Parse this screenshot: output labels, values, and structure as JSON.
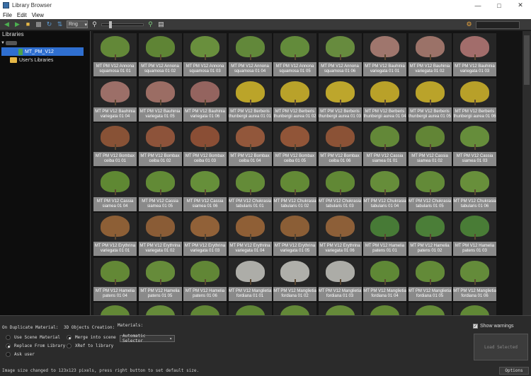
{
  "window": {
    "title": "Library Browser"
  },
  "menu": [
    "File",
    "Edit",
    "View"
  ],
  "toolbar": {
    "select_value": "Rng"
  },
  "left_panel": {
    "header": "Libraries",
    "items": [
      {
        "label": "MT_PM_V12",
        "selected": true
      },
      {
        "label": "User's Libraries",
        "selected": false
      }
    ]
  },
  "grid": {
    "tiles": [
      [
        "MT PM V12 Annona squamosa 01 01",
        "MT PM V12 Annona squamosa 01 02",
        "MT PM V12 Annona squamosa 01 03",
        "MT PM V12 Annona squamosa 01 04",
        "MT PM V12 Annona squamosa 01 05",
        "MT PM V12 Annona squamosa 01 06",
        "MT PM V12 Bauhinia variegata 01 01",
        "MT PM V12 Bauhinia variegata 01 02",
        "MT PM V12 Bauhinia variegata 01 03"
      ],
      [
        "MT PM V12 Bauhinia variegata 01 04",
        "MT PM V12 Bauhinia variegata 01 05",
        "MT PM V12 Bauhinia variegata 01 06",
        "MT PM V12 Berberis thunbergii aurea 01 01",
        "MT PM V12 Berberis thunbergii aurea 01 02",
        "MT PM V12 Berberis thunbergii aurea 01 03",
        "MT PM V12 Berberis thunbergii aurea 01 04",
        "MT PM V12 Berberis thunbergii aurea 01 05",
        "MT PM V12 Berberis thunbergii aurea 01 06"
      ],
      [
        "MT PM V12 Bombax ceiba 01 01",
        "MT PM V12 Bombax ceiba 01 02",
        "MT PM V12 Bombax ceiba 01 03",
        "MT PM V12 Bombax ceiba 01 04",
        "MT PM V12 Bombax ceiba 01 05",
        "MT PM V12 Bombax ceiba 01 06",
        "MT PM V12 Cassia siamea 01 01",
        "MT PM V12 Cassia siamea 01 02",
        "MT PM V12 Cassia siamea 01 03"
      ],
      [
        "MT PM V12 Cassia siamea 01 04",
        "MT PM V12 Cassia siamea 01 05",
        "MT PM V12 Cassia siamea 01 06",
        "MT PM V12 Chukrasia tabularis 01 01",
        "MT PM V12 Chukrasia tabularis 01 02",
        "MT PM V12 Chukrasia tabularis 01 03",
        "MT PM V12 Chukrasia tabularis 01 04",
        "MT PM V12 Chukrasia tabularis 01 05",
        "MT PM V12 Chukrasia tabularis 01 06"
      ],
      [
        "MT PM V12 Erythrina variegata 01 01",
        "MT PM V12 Erythrina variegata 01 02",
        "MT PM V12 Erythrina variegata 01 03",
        "MT PM V12 Erythrina variegata 01 04",
        "MT PM V12 Erythrina variegata 01 05",
        "MT PM V12 Erythrina variegata 01 06",
        "MT PM V12 Hamelia patens 01 01",
        "MT PM V12 Hamelia patens 01 02",
        "MT PM V12 Hamelia patens 01 03"
      ],
      [
        "MT PM V12 Hamelia patens 01 04",
        "MT PM V12 Hamelia patens 01 05",
        "MT PM V12 Hamelia patens 01 06",
        "MT PM V12 Manglietia fordiana 01 01",
        "MT PM V12 Manglietia fordiana 01 02",
        "MT PM V12 Manglietia fordiana 01 03",
        "MT PM V12 Manglietia fordiana 01 04",
        "MT PM V12 Manglietia fordiana 01 05",
        "MT PM V12 Manglietia fordiana 01 06"
      ],
      [
        "",
        "",
        "",
        "",
        "",
        "",
        "",
        "",
        ""
      ]
    ],
    "plant_colors": [
      [
        "#6f9a3c",
        "#6a9538",
        "#76a242",
        "#6d9a3e",
        "#6f9d40",
        "#739e43",
        "#b5857a",
        "#b08074",
        "#b87a78"
      ],
      [
        "#b27c74",
        "#b07a70",
        "#a8706a",
        "#d6bb2a",
        "#d4b82c",
        "#d8bd2e",
        "#d3b72a",
        "#d5ba2c",
        "#d2b62a"
      ],
      [
        "#9a5a3a",
        "#a05c3e",
        "#9c5638",
        "#a66040",
        "#a45e3c",
        "#9e5a3a",
        "#6f9a3c",
        "#6d963a",
        "#72a040"
      ],
      [
        "#6a9a36",
        "#6d9c3a",
        "#72a23e",
        "#709e3c",
        "#6e9c3a",
        "#6c9a38",
        "#72a03e",
        "#6e9c3c",
        "#74a240"
      ],
      [
        "#a06a3a",
        "#9c663a",
        "#a46c3c",
        "#a26a3a",
        "#9e683a",
        "#a06a3c",
        "#4e8a3a",
        "#528e3c",
        "#508c3a"
      ],
      [
        "#6e9a3a",
        "#729e3e",
        "#6c983a",
        "#c6c6c0",
        "#c8c8c2",
        "#c4c4be",
        "#6a9a3a",
        "#6e9c3c",
        "#709e3e"
      ],
      [
        "#6e9a3a",
        "#729e3e",
        "#6c983a",
        "#6a963a",
        "#6e9a3c",
        "#729c3e",
        "#6e9a3a",
        "#709c3c",
        "#6c9a3a"
      ]
    ]
  },
  "bottom": {
    "duplicate_title": "On Duplicate Material:",
    "duplicate_options": [
      {
        "label": "Use Scene Material",
        "checked": false
      },
      {
        "label": "Replace From Library",
        "checked": true
      },
      {
        "label": "Ask user",
        "checked": false
      }
    ],
    "creation_title": "3D Objects Creation:",
    "creation_options": [
      {
        "label": "Merge into scene",
        "checked": true
      },
      {
        "label": "XRef to library",
        "checked": false
      }
    ],
    "materials_title": "Materials:",
    "materials_value": "Automatic Selector",
    "show_warnings": "Show warnings",
    "load_button": "Load Selected",
    "status": "Image size changed to 123x123 pixels, press right button to set default size.",
    "options_button": "Options"
  }
}
